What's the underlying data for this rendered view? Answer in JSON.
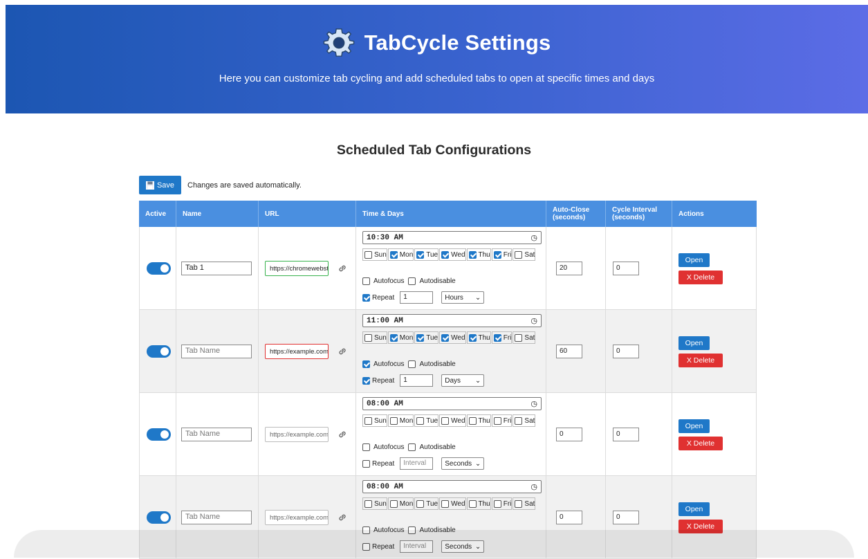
{
  "header": {
    "title": "TabCycle Settings",
    "subtitle": "Here you can customize tab cycling and add scheduled tabs to open at specific times and days",
    "icon": "gear-icon"
  },
  "section_title": "Scheduled Tab Configurations",
  "toolbar": {
    "save_label": "Save",
    "save_note": "Changes are saved automatically."
  },
  "columns": [
    "Active",
    "Name",
    "URL",
    "Time & Days",
    "Auto-Close (seconds)",
    "Cycle Interval (seconds)",
    "Actions"
  ],
  "day_labels": [
    "Sun",
    "Mon",
    "Tue",
    "Wed",
    "Thu",
    "Fri",
    "Sat"
  ],
  "labels": {
    "autofocus": "Autofocus",
    "autodisable": "Autodisable",
    "repeat": "Repeat",
    "open": "Open",
    "delete": "X Delete",
    "interval_placeholder": "Interval"
  },
  "colors": {
    "header_start": "#1c56b2",
    "header_end": "#5c6ce6",
    "primary": "#1f78c8",
    "danger": "#e03131",
    "table_header": "#4a8fe0"
  },
  "rows": [
    {
      "active": true,
      "name": "Tab 1",
      "name_placeholder": false,
      "url": "https://chromewebstore",
      "url_state": "valid",
      "time": "10:30 AM",
      "days": [
        false,
        true,
        true,
        true,
        true,
        true,
        false
      ],
      "autofocus": false,
      "autodisable": false,
      "repeat": true,
      "repeat_value": "1",
      "repeat_value_placeholder": false,
      "repeat_unit": "Hours",
      "auto_close": "20",
      "cycle_interval": "0"
    },
    {
      "active": true,
      "name": "Tab Name",
      "name_placeholder": true,
      "url": "https://example.com",
      "url_state": "invalid",
      "time": "11:00 AM",
      "days": [
        false,
        true,
        true,
        true,
        true,
        true,
        false
      ],
      "autofocus": true,
      "autodisable": false,
      "repeat": true,
      "repeat_value": "1",
      "repeat_value_placeholder": false,
      "repeat_unit": "Days",
      "auto_close": "60",
      "cycle_interval": "0"
    },
    {
      "active": true,
      "name": "Tab Name",
      "name_placeholder": true,
      "url": "https://example.com",
      "url_state": "placeholder",
      "time": "08:00 AM",
      "days": [
        false,
        false,
        false,
        false,
        false,
        false,
        false
      ],
      "autofocus": false,
      "autodisable": false,
      "repeat": false,
      "repeat_value": "Interval",
      "repeat_value_placeholder": true,
      "repeat_unit": "Seconds",
      "auto_close": "0",
      "cycle_interval": "0"
    },
    {
      "active": true,
      "name": "Tab Name",
      "name_placeholder": true,
      "url": "https://example.com",
      "url_state": "placeholder",
      "time": "08:00 AM",
      "days": [
        false,
        false,
        false,
        false,
        false,
        false,
        false
      ],
      "autofocus": false,
      "autodisable": false,
      "repeat": false,
      "repeat_value": "Interval",
      "repeat_value_placeholder": true,
      "repeat_unit": "Seconds",
      "auto_close": "0",
      "cycle_interval": "0"
    }
  ]
}
